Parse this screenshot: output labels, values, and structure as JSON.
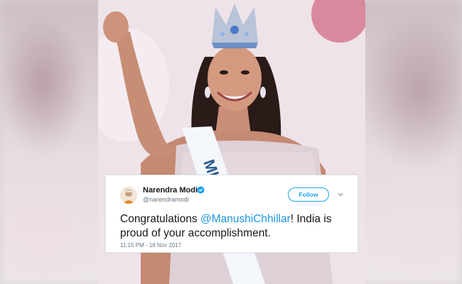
{
  "tweet": {
    "author_name": "Narendra Modi",
    "author_handle": "@narendramodi",
    "follow_label": "Follow",
    "text_before": "Congratulations ",
    "mention": "@ManushiChhillar",
    "text_after": "! India is proud of your accomplishment.",
    "timestamp": "11:15 PM - 18 Nov 2017"
  },
  "icons": {
    "verified": "verified-badge-icon",
    "menu": "chevron-down-icon"
  },
  "colors": {
    "twitter_blue": "#1da1f2",
    "mention_blue": "#1b95e0",
    "text": "#14171a",
    "muted": "#657786"
  },
  "photo": {
    "sash_text": "MISS"
  }
}
